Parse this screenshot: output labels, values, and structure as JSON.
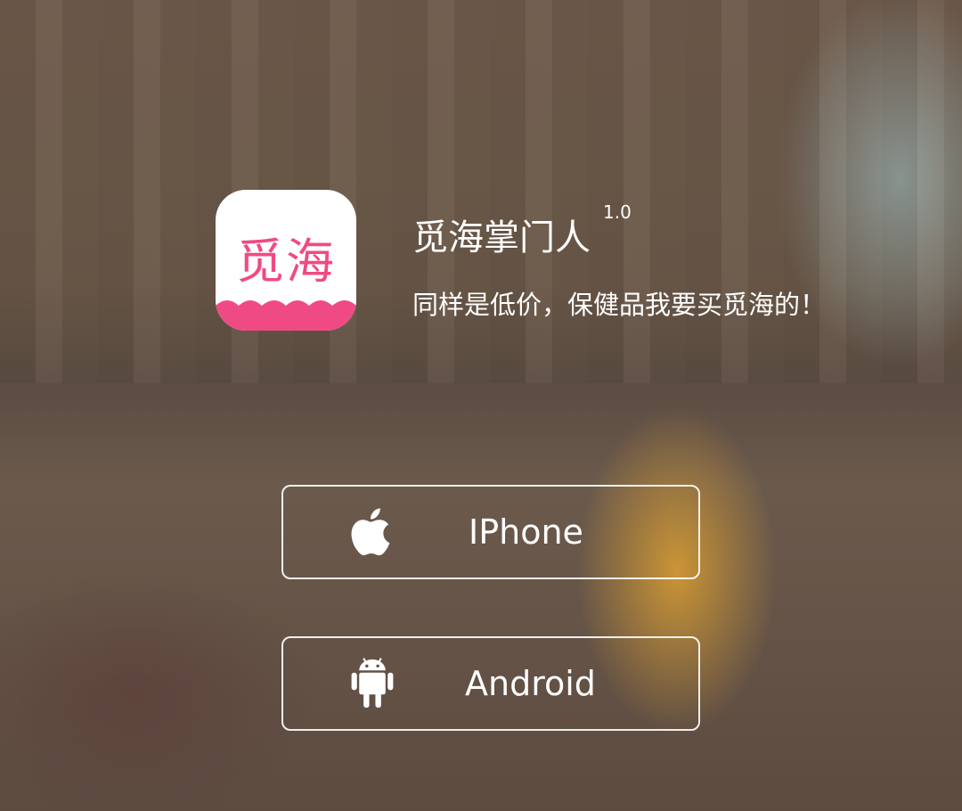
{
  "app": {
    "icon_text": "觅海",
    "name": "觅海掌门人",
    "version": "1.0",
    "slogan": "同样是低价，保健品我要买觅海的！"
  },
  "buttons": [
    {
      "label": "IPhone",
      "icon": "apple-icon"
    },
    {
      "label": "Android",
      "icon": "android-icon"
    }
  ],
  "colors": {
    "brand": "#f04a84"
  }
}
